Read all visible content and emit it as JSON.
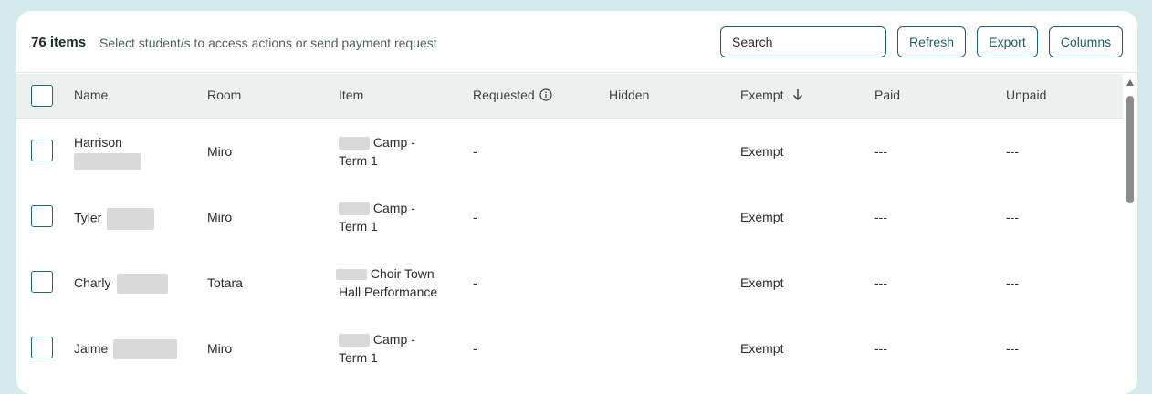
{
  "toolbar": {
    "count": "76 items",
    "hint": "Select student/s to access actions or send payment request",
    "search_placeholder": "Search",
    "refresh_label": "Refresh",
    "export_label": "Export",
    "columns_label": "Columns"
  },
  "columns": {
    "name": "Name",
    "room": "Room",
    "item": "Item",
    "requested": "Requested",
    "hidden": "Hidden",
    "exempt": "Exempt",
    "paid": "Paid",
    "unpaid": "Unpaid"
  },
  "rows": [
    {
      "name": "Harrison",
      "room": "Miro",
      "item_line1": "Camp -",
      "item_line2": "Term 1",
      "requested": "-",
      "hidden": "",
      "exempt": "Exempt",
      "paid": "---",
      "unpaid": "---"
    },
    {
      "name": "Tyler",
      "room": "Miro",
      "item_line1": "Camp -",
      "item_line2": "Term 1",
      "requested": "-",
      "hidden": "",
      "exempt": "Exempt",
      "paid": "---",
      "unpaid": "---"
    },
    {
      "name": "Charly",
      "room": "Totara",
      "item_line1": "Choir Town",
      "item_line2": "Hall Performance",
      "requested": "-",
      "hidden": "",
      "exempt": "Exempt",
      "paid": "---",
      "unpaid": "---"
    },
    {
      "name": "Jaime",
      "room": "Miro",
      "item_line1": "Camp -",
      "item_line2": "Term 1",
      "requested": "-",
      "hidden": "",
      "exempt": "Exempt",
      "paid": "---",
      "unpaid": "---"
    }
  ],
  "icons": {
    "requested_info": "info-circle-icon",
    "exempt_sort": "arrow-down-icon",
    "scroll_up": "triangle-up-icon"
  },
  "colors": {
    "accent": "#1d5f66",
    "page_bg": "#d4ebec",
    "header_bg": "#eef0f0"
  }
}
